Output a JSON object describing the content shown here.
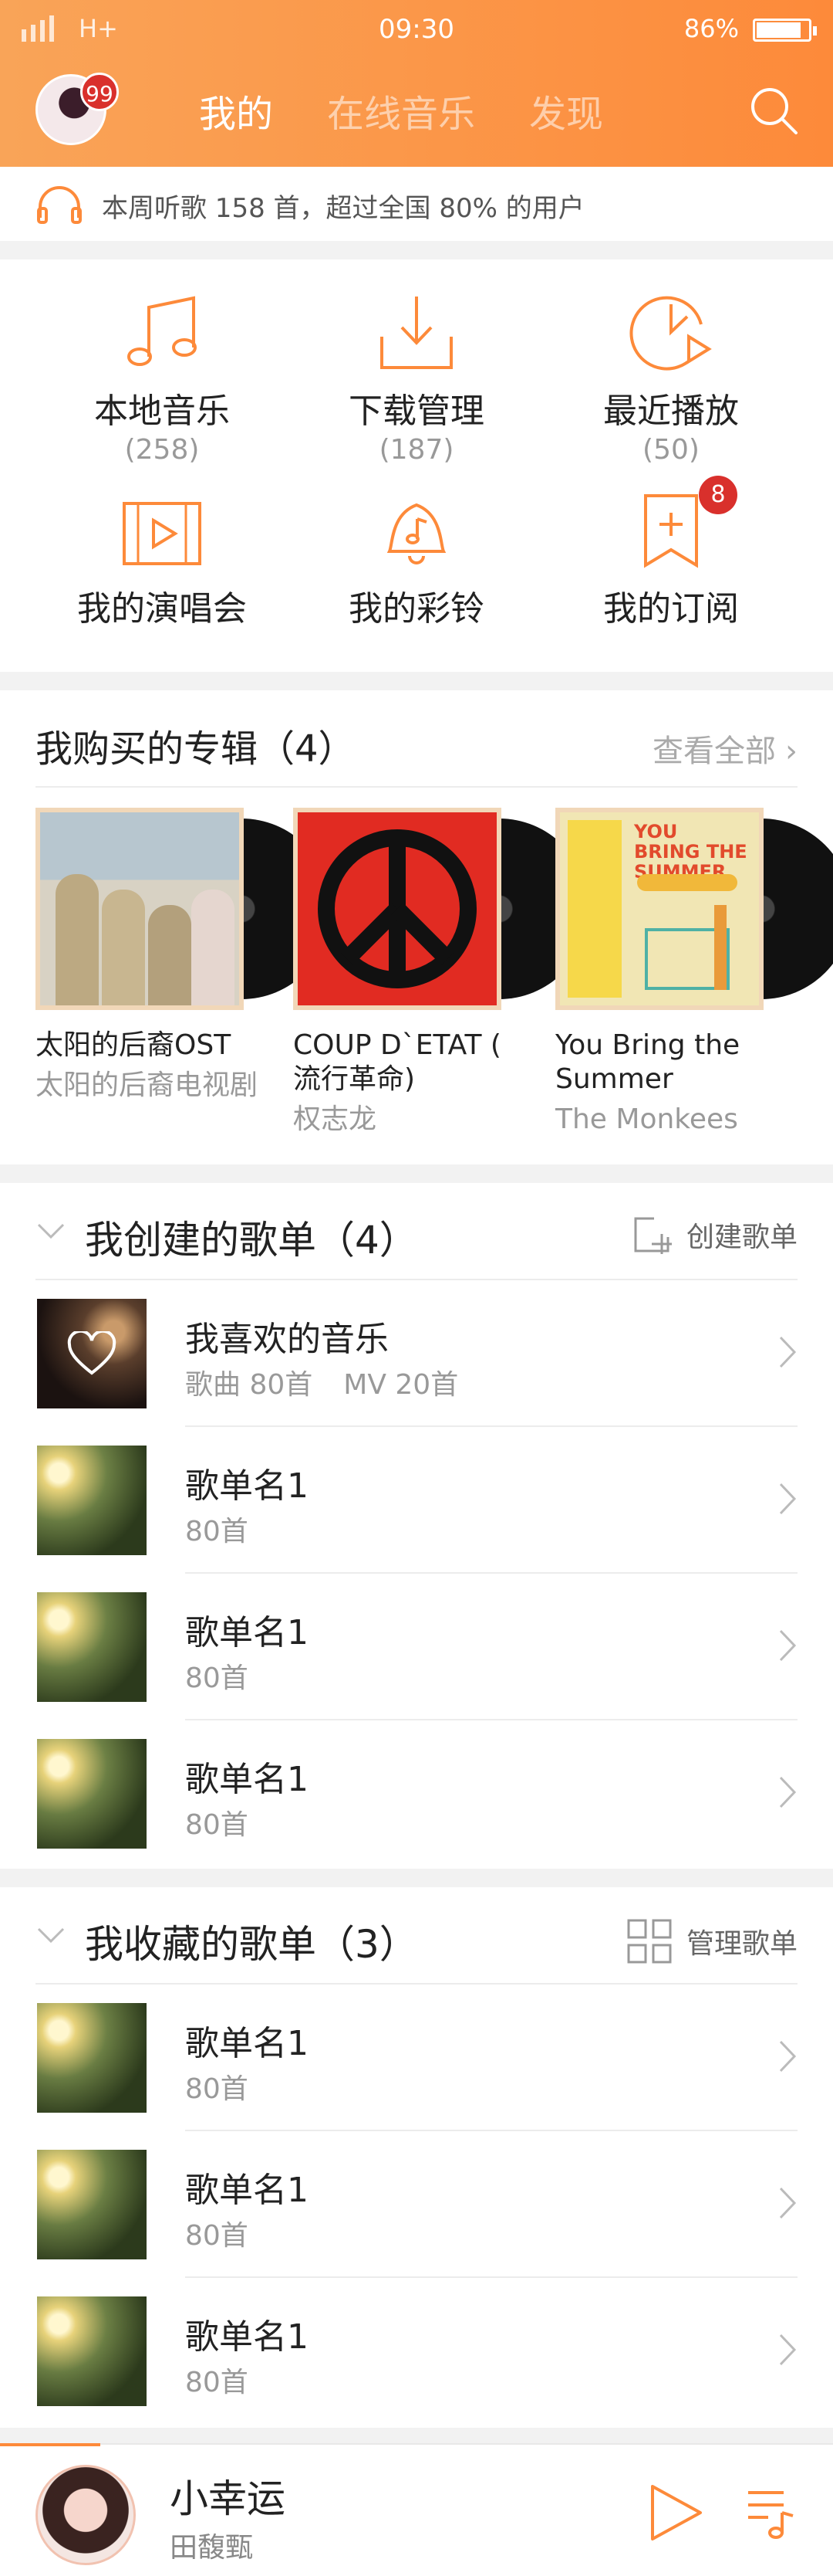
{
  "status_bar": {
    "network": "H+",
    "time": "09:30",
    "battery": "86%"
  },
  "header": {
    "avatar_badge": "99",
    "tabs": [
      {
        "label": "我的",
        "active": true
      },
      {
        "label": "在线音乐",
        "active": false
      },
      {
        "label": "发现",
        "active": false
      }
    ]
  },
  "notice": {
    "text": "本周听歌 158 首，超过全国 80% 的用户"
  },
  "shortcuts": [
    {
      "label": "本地音乐",
      "count": "(258)",
      "icon": "music-note-icon"
    },
    {
      "label": "下载管理",
      "count": "(187)",
      "icon": "download-icon"
    },
    {
      "label": "最近播放",
      "count": "(50)",
      "icon": "recent-play-icon"
    },
    {
      "label": "我的演唱会",
      "count": "",
      "icon": "concert-video-icon"
    },
    {
      "label": "我的彩铃",
      "count": "",
      "icon": "ringtone-bell-icon"
    },
    {
      "label": "我的订阅",
      "count": "",
      "icon": "subscription-icon",
      "badge": "8"
    }
  ],
  "albums_section": {
    "title": "我购买的专辑（4）",
    "view_all": "查看全部",
    "items": [
      {
        "name": "太阳的后裔OST",
        "sub": "太阳的后裔电视剧"
      },
      {
        "name": "COUP D`ETAT ( 流行革命)",
        "sub": "权志龙"
      },
      {
        "name": "You Bring the Summer",
        "sub": "The Monkees",
        "cover_text": "YOU BRING THE SUMMER"
      }
    ]
  },
  "created_playlists": {
    "title": "我创建的歌单（4）",
    "action": "创建歌单",
    "items": [
      {
        "name": "我喜欢的音乐",
        "meta1": "歌曲 80首",
        "meta2": "MV 20首"
      },
      {
        "name": "歌单名1",
        "meta1": "80首",
        "meta2": ""
      },
      {
        "name": "歌单名1",
        "meta1": "80首",
        "meta2": ""
      },
      {
        "name": "歌单名1",
        "meta1": "80首",
        "meta2": ""
      }
    ]
  },
  "collected_playlists": {
    "title": "我收藏的歌单（3）",
    "action": "管理歌单",
    "items": [
      {
        "name": "歌单名1",
        "meta1": "80首"
      },
      {
        "name": "歌单名1",
        "meta1": "80首"
      },
      {
        "name": "歌单名1",
        "meta1": "80首"
      }
    ]
  },
  "player": {
    "song": "小幸运",
    "artist": "田馥甄"
  },
  "colors": {
    "accent": "#fd8a3a",
    "badge": "#d9302c"
  }
}
